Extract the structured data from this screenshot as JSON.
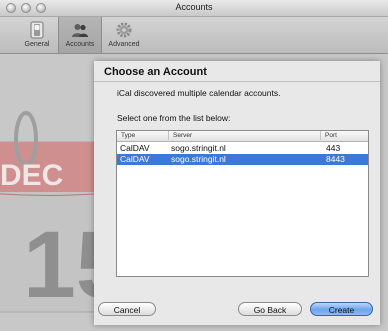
{
  "window": {
    "title": "Accounts"
  },
  "toolbar": {
    "items": [
      {
        "label": "General"
      },
      {
        "label": "Accounts"
      },
      {
        "label": "Advanced"
      }
    ]
  },
  "background": {
    "calendar_month": "DEC",
    "calendar_day": "15"
  },
  "sheet": {
    "heading": "Choose an Account",
    "message": "iCal discovered multiple calendar accounts.",
    "prompt": "Select one from the list below:",
    "table": {
      "headers": {
        "type": "Type",
        "server": "Server",
        "port": "Port"
      },
      "rows": [
        {
          "type": "CalDAV",
          "server": "sogo.stringit.nl",
          "port": "443",
          "selected": false
        },
        {
          "type": "CalDAV",
          "server": "sogo.stringit.nl",
          "port": "8443",
          "selected": true
        }
      ]
    },
    "buttons": {
      "cancel": "Cancel",
      "back": "Go Back",
      "create": "Create"
    }
  },
  "colors": {
    "selection": "#3d78d8",
    "primary_button": "#6ea4ec"
  }
}
